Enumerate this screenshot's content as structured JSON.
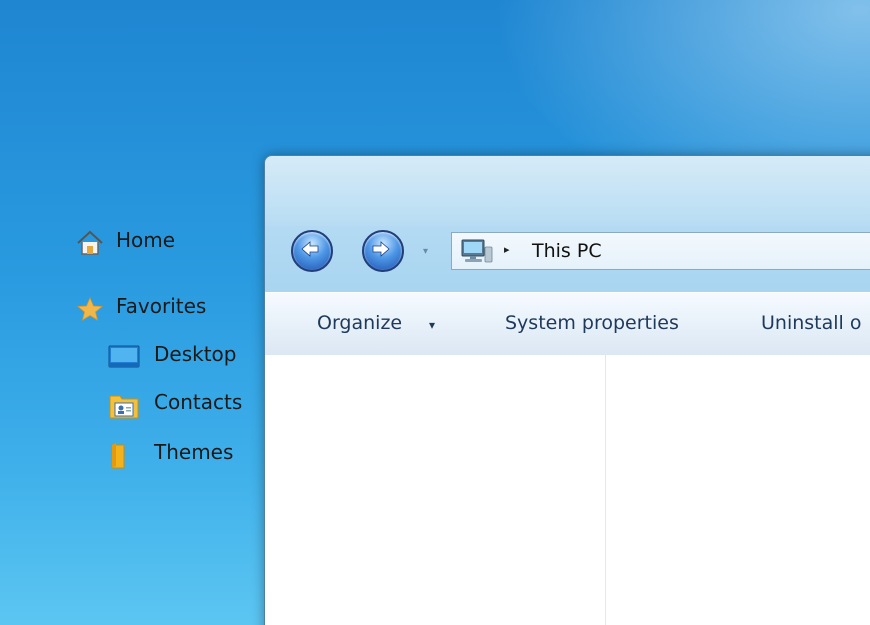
{
  "address": {
    "location": "This PC",
    "separator_glyph": "▸",
    "icon": "computer-monitor-icon"
  },
  "navigation": {
    "back_icon": "back-arrow-icon",
    "forward_icon": "forward-arrow-icon",
    "recent_dropdown_glyph": "▾"
  },
  "commandbar": {
    "organize": "Organize",
    "organize_arrow": "▾",
    "system_properties": "System properties",
    "uninstall": "Uninstall o"
  },
  "navpane": {
    "items": [
      {
        "label": "Home",
        "icon": "home-icon"
      },
      {
        "label": "Favorites",
        "icon": "star-icon"
      },
      {
        "label": "Desktop",
        "icon": "desktop-folder-icon"
      },
      {
        "label": "Contacts",
        "icon": "contacts-folder-icon"
      },
      {
        "label": "Themes",
        "icon": "themes-folder-icon"
      }
    ]
  },
  "colors": {
    "desktop_blue": "#2a9be0",
    "nav_button_blue": "#4e97e6",
    "command_text": "#1e395b",
    "favorites_star": "#f0b84a"
  }
}
